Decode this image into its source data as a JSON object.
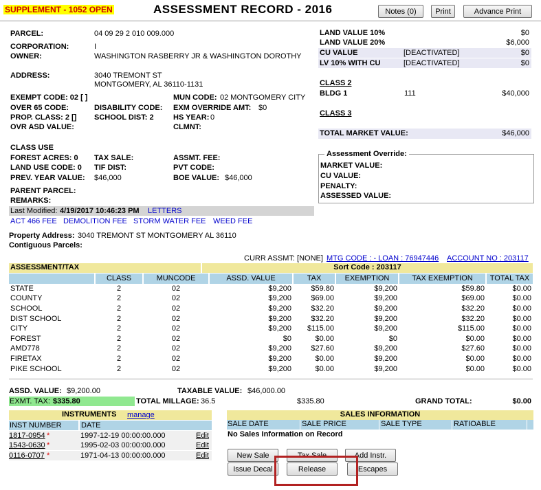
{
  "header": {
    "status_badge": "SUPPLEMENT - 1052  OPEN",
    "title": "ASSESSMENT RECORD - 2016",
    "notes_btn": "Notes (0)",
    "print_btn": "Print",
    "advance_print_btn": "Advance Print"
  },
  "parcel": {
    "parcel_label": "PARCEL:",
    "parcel": "04 09 29 2 010 009.000",
    "corp_label": "CORPORATION:",
    "corp": "I",
    "owner_label": "OWNER:",
    "owner": "WASHINGTON RASBERRY JR & WASHINGTON DOROTHY",
    "address_label": "ADDRESS:",
    "address1": "3040 TREMONT ST",
    "address2": "MONTGOMERY, AL  36110-1131",
    "exempt_code": "EXEMPT CODE: 02 [ ]",
    "mun_code_label": "MUN CODE:",
    "mun_code": "02   MONTGOMERY CITY",
    "over65_label": "OVER 65 CODE:",
    "disability_label": "DISABILITY CODE:",
    "exm_override_label": "EXM OVERRIDE AMT:",
    "exm_override": "$0",
    "prop_class": "PROP. CLASS: 2  []",
    "school_dist": "SCHOOL DIST: 2",
    "hs_year_label": "HS YEAR:",
    "hs_year": "0",
    "ovr_asd_label": "OVR ASD VALUE:",
    "clmnt_label": "CLMNT:"
  },
  "class_use": {
    "heading": "CLASS USE",
    "forest_acres": "FOREST ACRES: 0",
    "tax_sale_label": "TAX SALE:",
    "assmt_fee_label": "ASSMT. FEE:",
    "land_use_code": "LAND USE CODE: 0",
    "tif_dist_label": "TIF DIST:",
    "pvt_code_label": "PVT CODE:",
    "prev_year_label": "PREV. YEAR VALUE:",
    "prev_year": "$46,000",
    "boe_label": "BOE VALUE:",
    "boe": "$46,000",
    "parent_parcel_label": "PARENT PARCEL:",
    "remarks_label": "REMARKS:"
  },
  "modified": {
    "label": "Last Modified:",
    "value": "4/19/2017 10:46:23 PM",
    "letters": "LETTERS"
  },
  "fees": {
    "act466": "ACT 466 FEE",
    "demolition": "DEMOLITION FEE",
    "storm_water": "STORM WATER FEE",
    "weed": "WEED FEE"
  },
  "property": {
    "address_label": "Property Address:",
    "address": "3040 TREMONT ST  MONTGOMERY AL 36110",
    "contiguous_label": "Contiguous Parcels:"
  },
  "land": {
    "rows": [
      {
        "label": "LAND VALUE 10%",
        "mid": "",
        "value": "$0"
      },
      {
        "label": "LAND VALUE 20%",
        "mid": "",
        "value": "$6,000"
      },
      {
        "label": "CU VALUE",
        "mid": "[DEACTIVATED]",
        "value": "$0"
      },
      {
        "label": "LV 10% WITH CU",
        "mid": "[DEACTIVATED]",
        "value": "$0"
      }
    ],
    "class2_label": "CLASS 2",
    "bldg_label": "BLDG 1",
    "bldg_code": "111",
    "bldg_value": "$40,000",
    "class3_label": "CLASS 3",
    "total_label": "TOTAL MARKET VALUE:",
    "total_value": "$46,000"
  },
  "override": {
    "legend": "Assessment Override:",
    "market_label": "MARKET VALUE:",
    "cu_label": "CU VALUE:",
    "penalty_label": "PENALTY:",
    "assessed_label": "ASSESSED VALUE:"
  },
  "curr": {
    "curr_assmt": "CURR ASSMT: [NONE]",
    "mtg_code": "MTG CODE : - LOAN : 76947446",
    "account": "ACCOUNT NO : 203117"
  },
  "tax": {
    "header": "ASSESSMENT/TAX",
    "sort_code": "Sort Code : 203117",
    "columns": [
      "CLASS",
      "MUNCODE",
      "ASSD. VALUE",
      "TAX",
      "EXEMPTION",
      "TAX EXEMPTION",
      "TOTAL TAX"
    ],
    "rows": [
      {
        "name": "STATE",
        "class": "2",
        "mun": "02",
        "assd": "$9,200",
        "tax": "$59.80",
        "exemption": "$9,200",
        "tax_exemption": "$59.80",
        "total": "$0.00"
      },
      {
        "name": "COUNTY",
        "class": "2",
        "mun": "02",
        "assd": "$9,200",
        "tax": "$69.00",
        "exemption": "$9,200",
        "tax_exemption": "$69.00",
        "total": "$0.00"
      },
      {
        "name": "SCHOOL",
        "class": "2",
        "mun": "02",
        "assd": "$9,200",
        "tax": "$32.20",
        "exemption": "$9,200",
        "tax_exemption": "$32.20",
        "total": "$0.00"
      },
      {
        "name": "DIST SCHOOL",
        "class": "2",
        "mun": "02",
        "assd": "$9,200",
        "tax": "$32.20",
        "exemption": "$9,200",
        "tax_exemption": "$32.20",
        "total": "$0.00"
      },
      {
        "name": "CITY",
        "class": "2",
        "mun": "02",
        "assd": "$9,200",
        "tax": "$115.00",
        "exemption": "$9,200",
        "tax_exemption": "$115.00",
        "total": "$0.00"
      },
      {
        "name": "FOREST",
        "class": "2",
        "mun": "02",
        "assd": "$0",
        "tax": "$0.00",
        "exemption": "$0",
        "tax_exemption": "$0.00",
        "total": "$0.00"
      },
      {
        "name": "AMD778",
        "class": "2",
        "mun": "02",
        "assd": "$9,200",
        "tax": "$27.60",
        "exemption": "$9,200",
        "tax_exemption": "$27.60",
        "total": "$0.00"
      },
      {
        "name": "FIRETAX",
        "class": "2",
        "mun": "02",
        "assd": "$9,200",
        "tax": "$0.00",
        "exemption": "$9,200",
        "tax_exemption": "$0.00",
        "total": "$0.00"
      },
      {
        "name": "PIKE SCHOOL",
        "class": "2",
        "mun": "02",
        "assd": "$9,200",
        "tax": "$0.00",
        "exemption": "$9,200",
        "tax_exemption": "$0.00",
        "total": "$0.00"
      }
    ]
  },
  "totals": {
    "assd_value_label": "ASSD. VALUE:",
    "assd_value": "$9,200.00",
    "taxable_label": "TAXABLE VALUE:",
    "taxable_value": "$46,000.00",
    "exmt_tax_label": "EXMT. TAX:",
    "exmt_tax": "$335.80",
    "millage_label": "TOTAL MILLAGE:",
    "millage": "36.5",
    "tax_sum": "$335.80",
    "grand_label": "GRAND TOTAL:",
    "grand_value": "$0.00"
  },
  "instruments": {
    "header": "INSTRUMENTS",
    "manage": "manage",
    "col_number": "INST NUMBER",
    "col_date": "DATE",
    "rows": [
      {
        "number": "1817-0954",
        "star": "*",
        "date": "1997-12-19 00:00:00.000",
        "edit": "Edit"
      },
      {
        "number": "1543-0630",
        "star": "*",
        "date": "1995-02-03 00:00:00.000",
        "edit": "Edit"
      },
      {
        "number": "0116-0707",
        "star": "*",
        "date": "1971-04-13 00:00:00.000",
        "edit": "Edit"
      }
    ]
  },
  "sales": {
    "header": "SALES INFORMATION",
    "columns": [
      "SALE DATE",
      "SALE PRICE",
      "SALE TYPE",
      "RATIOABLE"
    ],
    "empty": "No Sales Information on Record"
  },
  "actions": {
    "new_sale": "New Sale",
    "tax_sale": "Tax Sale",
    "add_instr": "Add Instr.",
    "issue_decal": "Issue Decal",
    "release": "Release",
    "escapes": "Escapes"
  },
  "colors": {
    "highlight_box": "#b22222",
    "yellow_header": "#f0e89c",
    "blue_header": "#b0d4e6",
    "green_cell": "#90e890"
  }
}
